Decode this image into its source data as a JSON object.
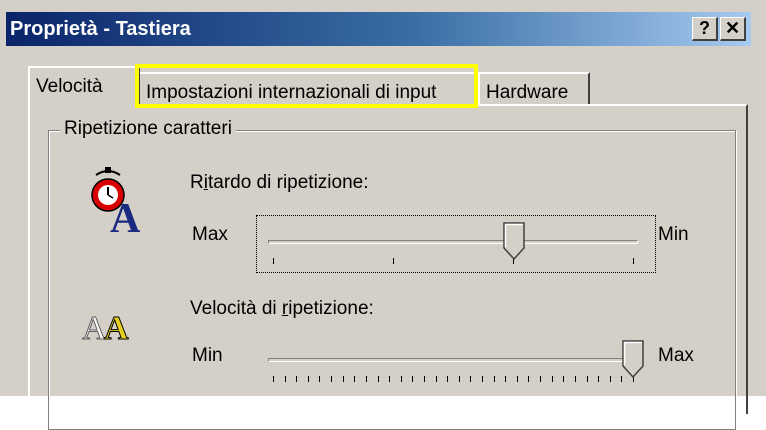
{
  "window": {
    "title": "Proprietà - Tastiera",
    "help_button": "?",
    "close_button": "✕"
  },
  "tabs": [
    {
      "label": "Velocità",
      "active": true
    },
    {
      "label": "Impostazioni internazionali di input",
      "active": false,
      "highlighted": true
    },
    {
      "label": "Hardware",
      "active": false
    }
  ],
  "group": {
    "title": "Ripetizione caratteri",
    "delay": {
      "label_pre": "R",
      "label_mnemonic": "i",
      "label_post": "tardo di ripetizione:",
      "min_side_label": "Max",
      "max_side_label": "Min",
      "value_fraction": 0.67,
      "tick_count": 4
    },
    "rate": {
      "label_pre": "Velocità di ",
      "label_mnemonic": "r",
      "label_post": "ipetizione:",
      "min_side_label": "Min",
      "max_side_label": "Max",
      "value_fraction": 1.0,
      "tick_count": 32
    }
  },
  "colors": {
    "face": "#d4d0c8",
    "title_start": "#0a246a",
    "title_end": "#a6caf0",
    "highlight": "#ffff00"
  },
  "icons": [
    "stopwatch-a-icon",
    "double-a-icon"
  ]
}
